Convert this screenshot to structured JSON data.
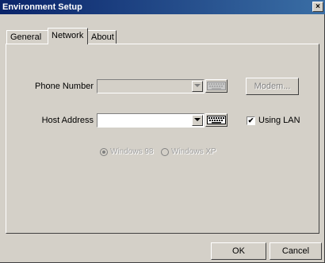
{
  "window": {
    "title": "Environment Setup",
    "close_glyph": "×"
  },
  "tabs": [
    {
      "label": "General",
      "active": false
    },
    {
      "label": "Network",
      "active": true
    },
    {
      "label": "About",
      "active": false
    }
  ],
  "network": {
    "phone_number_label": "Phone Number",
    "phone_number_value": "",
    "modem_button_label": "Modem...",
    "host_address_label": "Host Address",
    "host_address_value": "",
    "using_lan_label": "Using LAN",
    "using_lan_checked": "✔",
    "radio_win98_label": "Windows 98",
    "radio_winxp_label": "Windows XP"
  },
  "footer": {
    "ok_label": "OK",
    "cancel_label": "Cancel"
  },
  "icons": {
    "keyboard": "keyboard-icon",
    "dropdown": "chevron-down-icon",
    "close": "close-icon"
  }
}
